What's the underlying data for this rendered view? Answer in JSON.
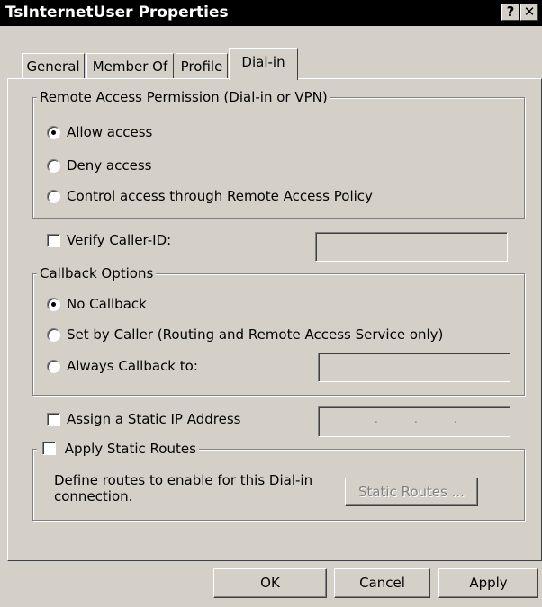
{
  "window": {
    "title": "TsInternetUser Properties",
    "help_glyph": "?",
    "close_glyph": "✕"
  },
  "tabs": [
    {
      "label": "General"
    },
    {
      "label": "Member Of"
    },
    {
      "label": "Profile"
    },
    {
      "label": "Dial-in",
      "active": true
    }
  ],
  "remote_access": {
    "legend": "Remote Access Permission (Dial-in or VPN)",
    "options": [
      {
        "label": "Allow access",
        "selected": true
      },
      {
        "label": "Deny access",
        "selected": false
      },
      {
        "label": "Control access through Remote Access Policy",
        "selected": false
      }
    ]
  },
  "verify_caller_id": {
    "label": "Verify Caller-ID:",
    "checked": false,
    "value": ""
  },
  "callback": {
    "legend": "Callback Options",
    "options": [
      {
        "label": "No Callback",
        "selected": true
      },
      {
        "label": "Set by Caller (Routing and Remote Access Service only)",
        "selected": false
      },
      {
        "label": "Always Callback to:",
        "selected": false
      }
    ],
    "always_callback_value": ""
  },
  "static_ip": {
    "label": "Assign a Static IP Address",
    "checked": false,
    "ip_separator": "."
  },
  "static_routes": {
    "label": "Apply Static Routes",
    "checked": false,
    "description_line1": "Define routes to enable for this Dial-in",
    "description_line2": "connection.",
    "button_label": "Static Routes ..."
  },
  "footer": {
    "ok_label": "OK",
    "cancel_label": "Cancel",
    "apply_label": "Apply"
  }
}
